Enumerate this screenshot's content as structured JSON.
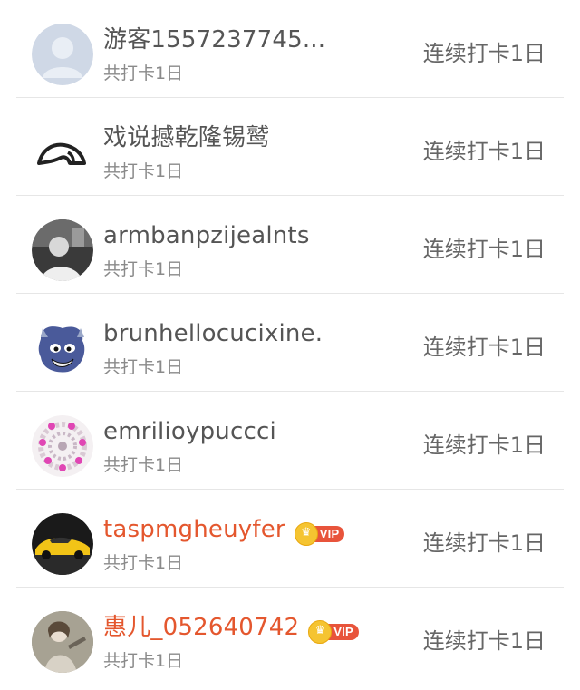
{
  "rows": [
    {
      "name": "游客1557237745...",
      "sub": "共打卡1日",
      "streak": "连续打卡1日",
      "vip": false,
      "avatar": "default-user-icon"
    },
    {
      "name": "戏说撼乾隆锡鹫",
      "sub": "共打卡1日",
      "streak": "连续打卡1日",
      "vip": false,
      "avatar": "helmet-logo"
    },
    {
      "name": "armbanpzijealnts",
      "sub": "共打卡1日",
      "streak": "连续打卡1日",
      "vip": false,
      "avatar": "photo"
    },
    {
      "name": "brunhellocucixine.",
      "sub": "共打卡1日",
      "streak": "连续打卡1日",
      "vip": false,
      "avatar": "cartoon-creature"
    },
    {
      "name": "emrilioypuccci",
      "sub": "共打卡1日",
      "streak": "连续打卡1日",
      "vip": false,
      "avatar": "flower-pattern"
    },
    {
      "name": "taspmgheuyfer",
      "sub": "共打卡1日",
      "streak": "连续打卡1日",
      "vip": true,
      "vip_label": "VIP",
      "avatar": "yellow-car"
    },
    {
      "name": "惠儿_052640742",
      "sub": "共打卡1日",
      "streak": "连续打卡1日",
      "vip": true,
      "vip_label": "VIP",
      "avatar": "illustrated-person"
    }
  ],
  "colors": {
    "vip_name": "#e4572e",
    "normal_name": "#555555",
    "divider": "#e6e6e6"
  }
}
